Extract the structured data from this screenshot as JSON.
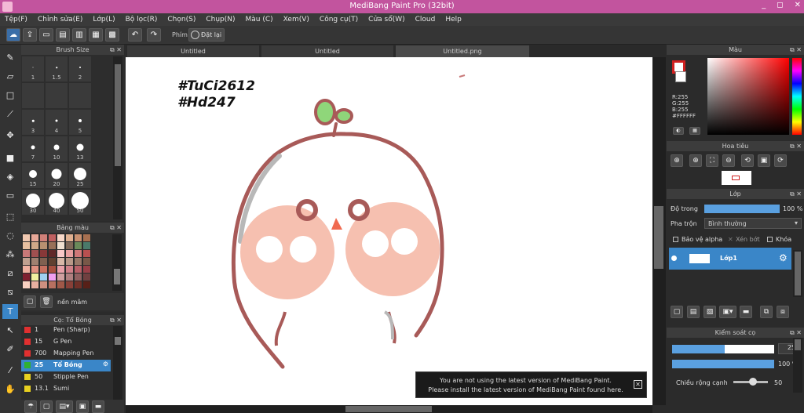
{
  "window": {
    "title": "MediBang Paint Pro (32bit)",
    "controls": [
      "_",
      "◻",
      "✕"
    ]
  },
  "menu": [
    "Tệp(F)",
    "Chỉnh sửa(E)",
    "Lớp(L)",
    "Bộ lọc(R)",
    "Chọn(S)",
    "Chụp(N)",
    "Màu (C)",
    "Xem(V)",
    "Công cụ(T)",
    "Cửa sổ(W)",
    "Cloud",
    "Help"
  ],
  "toolbar": {
    "filter_label": "Phím",
    "reset_label": "Đặt lại"
  },
  "brush_size": {
    "title": "Brush Size",
    "sizes": [
      "1",
      "1.5",
      "2",
      "",
      "",
      "",
      "3",
      "4",
      "5",
      "7",
      "10",
      "13",
      "15",
      "20",
      "25",
      "30",
      "40",
      "50"
    ]
  },
  "palette": {
    "title": "Bảng màu",
    "name": "nền mâm"
  },
  "brush_panel": {
    "title": "Cọ: Tổ Bóng",
    "brushes": [
      {
        "size": "1",
        "name": "Pen (Sharp)",
        "color": "#e03030"
      },
      {
        "size": "15",
        "name": "G Pen",
        "color": "#e03030"
      },
      {
        "size": "700",
        "name": "Mapping Pen",
        "color": "#e03030"
      },
      {
        "size": "25",
        "name": "Tổ Bóng",
        "color": "#30b030",
        "selected": true
      },
      {
        "size": "50",
        "name": "Stipple Pen",
        "color": "#e8d020"
      },
      {
        "size": "13.1",
        "name": "Sumi",
        "color": "#e8d020"
      }
    ]
  },
  "tabs": [
    "Untitled",
    "Untitled",
    "Untitled.png"
  ],
  "canvas": {
    "hashtag1": "#TuCi2612",
    "hashtag2": "#Hd247"
  },
  "notice": {
    "line1": "You are not using the latest version of MediBang Paint.",
    "line2": "Please install the latest version of MediBang Paint found here."
  },
  "color_panel": {
    "title": "Màu",
    "r": "R:255",
    "g": "G:255",
    "b": "B:255",
    "hex": "#FFFFFF"
  },
  "navigator": {
    "title": "Hoa tiêu"
  },
  "layer_panel": {
    "title": "Lớp",
    "opacity_label": "Độ trong",
    "opacity_value": "100 %",
    "blend_label": "Pha trộn",
    "blend_value": "Bình thường",
    "protect_alpha": "Bảo vệ alpha",
    "clipping": "Xén bớt",
    "lock": "Khóa",
    "layer_name": "Lớp1"
  },
  "brush_control": {
    "title": "Kiểm soát cọ",
    "size_value": "25",
    "opacity_value": "100 %",
    "edge_label": "Chiều rộng cạnh",
    "edge_value": "50"
  }
}
